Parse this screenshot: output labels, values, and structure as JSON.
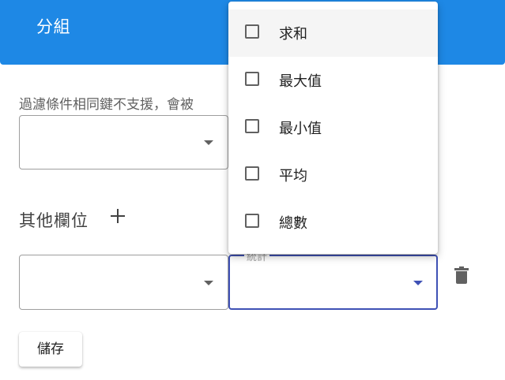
{
  "header": {
    "title": "分組"
  },
  "filter": {
    "hint": "過濾條件相同鍵不支援，會被"
  },
  "other_fields": {
    "title": "其他欄位"
  },
  "stat_field": {
    "label": "統計"
  },
  "actions": {
    "save_label": "儲存"
  },
  "dropdown": {
    "options": [
      {
        "label": "求和",
        "checked": false
      },
      {
        "label": "最大值",
        "checked": false
      },
      {
        "label": "最小值",
        "checked": false
      },
      {
        "label": "平均",
        "checked": false
      },
      {
        "label": "總數",
        "checked": false
      }
    ]
  },
  "colors": {
    "header_bg": "#1e88e5",
    "focus_border": "#3f51b5"
  }
}
